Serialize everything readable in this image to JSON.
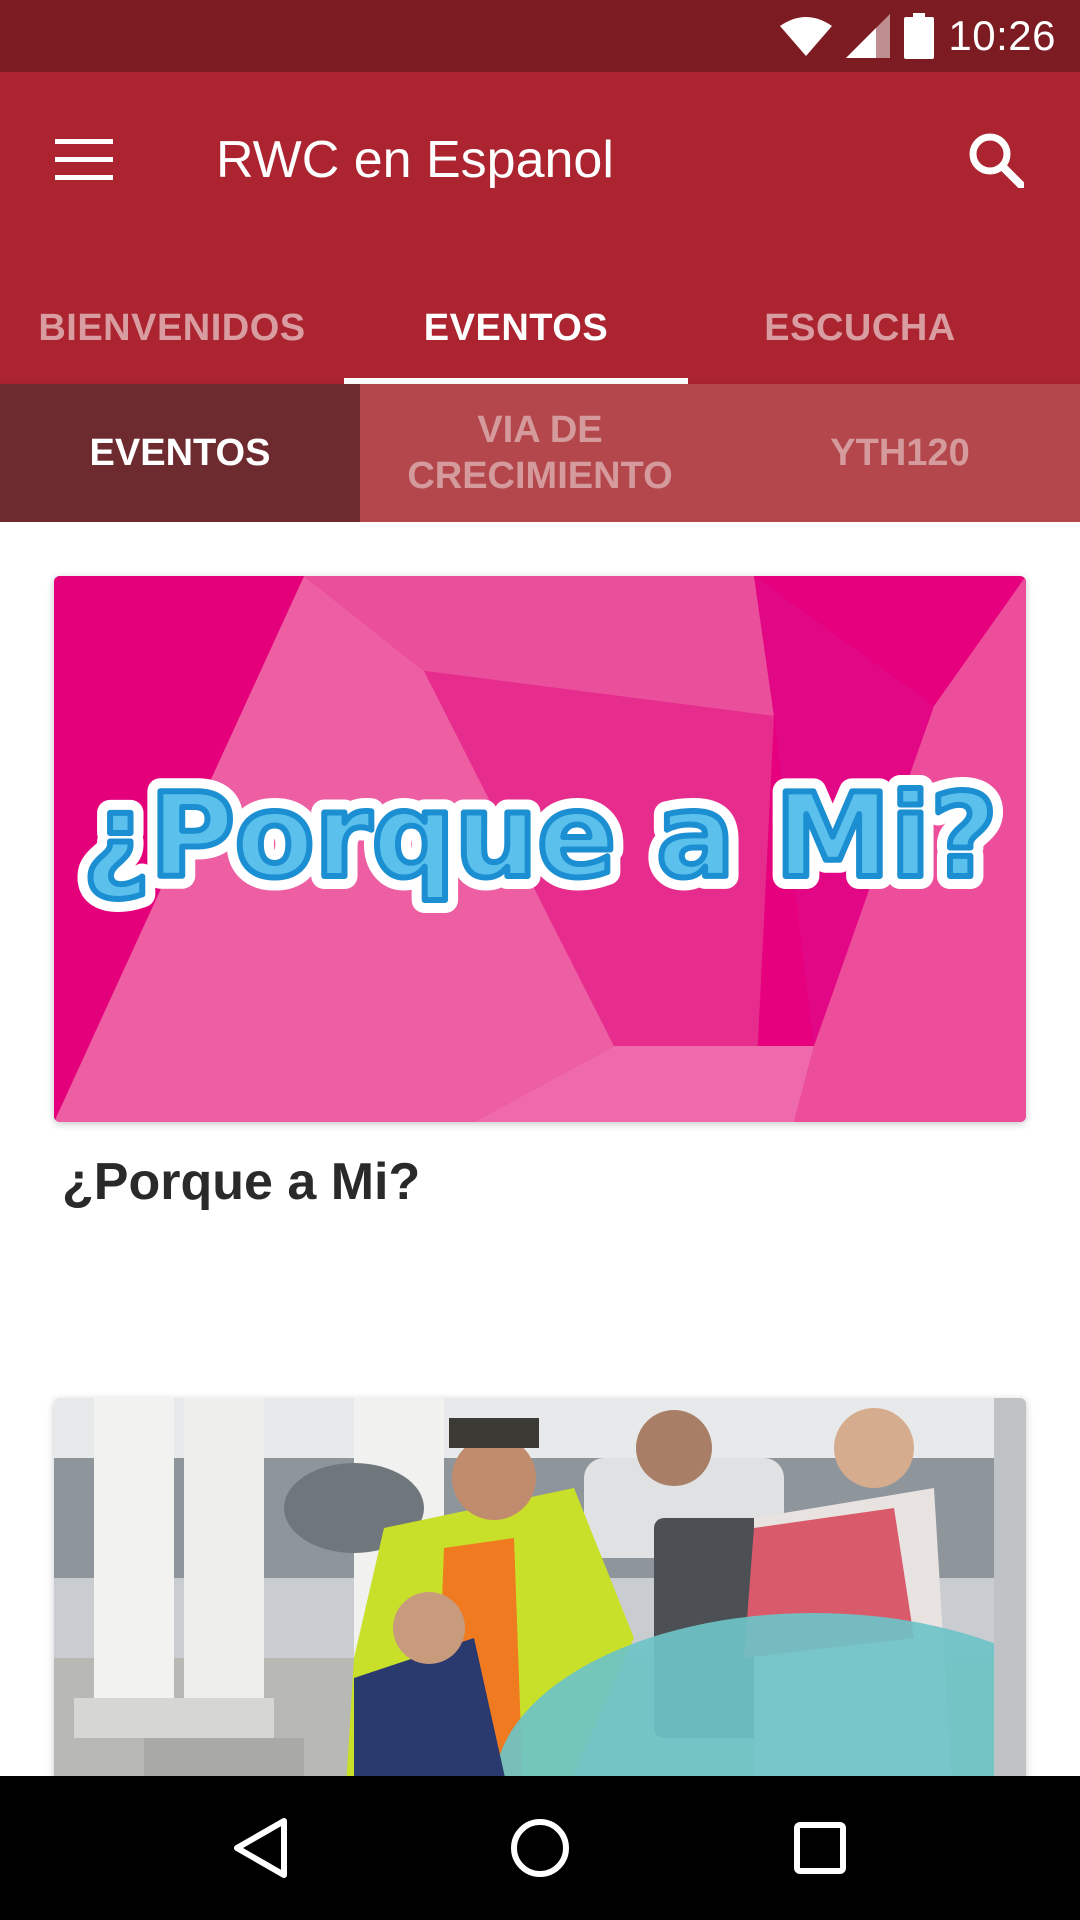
{
  "status_bar": {
    "time": "10:26",
    "icons": [
      "wifi-icon",
      "signal-icon",
      "battery-icon"
    ]
  },
  "app_bar": {
    "title": "RWC en Espanol",
    "menu_icon": "hamburger-menu-icon",
    "search_icon": "search-icon",
    "background": "#ab2430"
  },
  "tabs": [
    {
      "label": "BIENVENIDOS",
      "active": false
    },
    {
      "label": "EVENTOS",
      "active": true
    },
    {
      "label": "ESCUCHA",
      "active": false
    }
  ],
  "sub_tabs": [
    {
      "label": "EVENTOS",
      "active": true
    },
    {
      "label": "VIA DE\nCRECIMIENTO",
      "active": false
    },
    {
      "label": "YTH120",
      "active": false
    }
  ],
  "cards": [
    {
      "image_text": "¿Porque a Mi?",
      "title": "¿Porque a Mi?"
    },
    {
      "image_text": "",
      "title": ""
    }
  ],
  "nav_bar": {
    "icons": [
      "back-icon",
      "home-icon",
      "recents-icon"
    ]
  }
}
